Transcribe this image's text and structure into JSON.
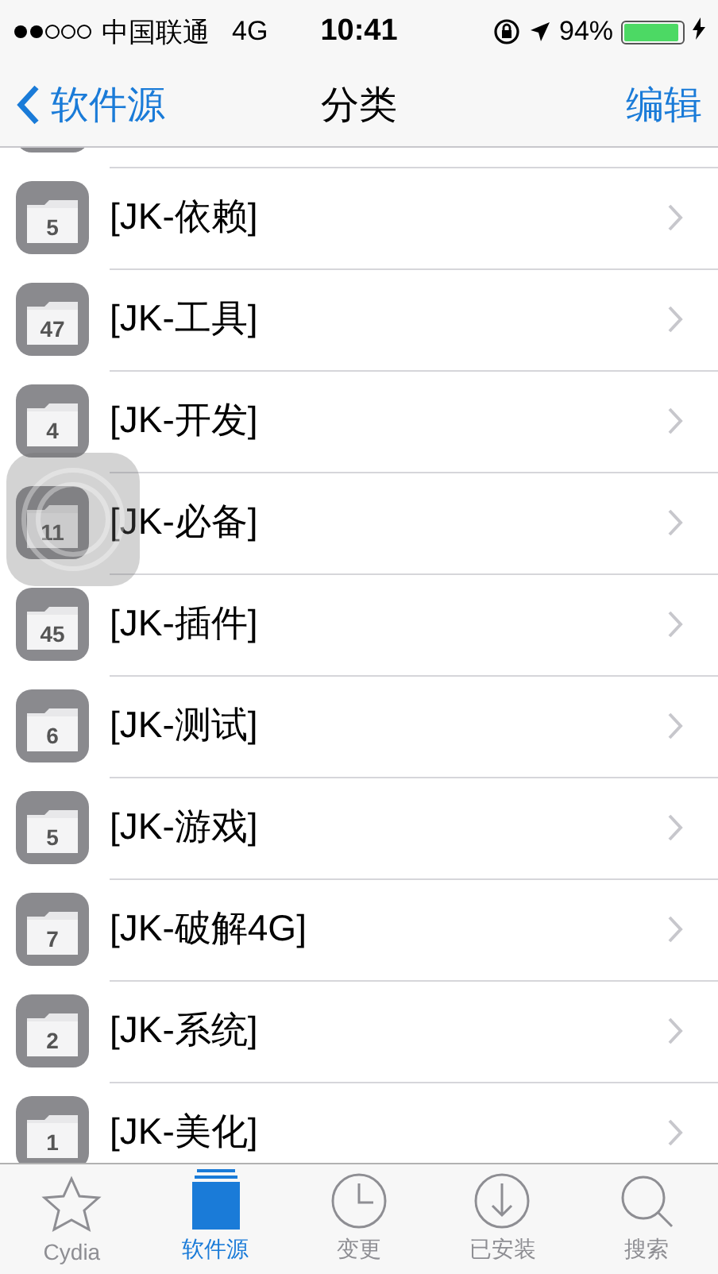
{
  "status_bar": {
    "carrier": "中国联通",
    "network": "4G",
    "time": "10:41",
    "battery_percent": "94%",
    "battery": {
      "level": 0.94
    }
  },
  "nav_bar": {
    "back": "软件源",
    "title": "分类",
    "action": "编辑"
  },
  "sections": [
    {
      "count": "5",
      "label": "[JK-依赖]"
    },
    {
      "count": "47",
      "label": "[JK-工具]"
    },
    {
      "count": "4",
      "label": "[JK-开发]"
    },
    {
      "count": "11",
      "label": "[JK-必备]"
    },
    {
      "count": "45",
      "label": "[JK-插件]"
    },
    {
      "count": "6",
      "label": "[JK-测试]"
    },
    {
      "count": "5",
      "label": "[JK-游戏]"
    },
    {
      "count": "7",
      "label": "[JK-破解4G]"
    },
    {
      "count": "2",
      "label": "[JK-系统]"
    },
    {
      "count": "1",
      "label": "[JK-美化]"
    }
  ],
  "tab_bar": [
    {
      "kind": "star",
      "label": "Cydia",
      "selected": false
    },
    {
      "kind": "sources",
      "label": "软件源",
      "selected": true
    },
    {
      "kind": "clock",
      "label": "变更",
      "selected": false
    },
    {
      "kind": "download",
      "label": "已安装",
      "selected": false
    },
    {
      "kind": "search",
      "label": "搜索",
      "selected": false
    }
  ]
}
